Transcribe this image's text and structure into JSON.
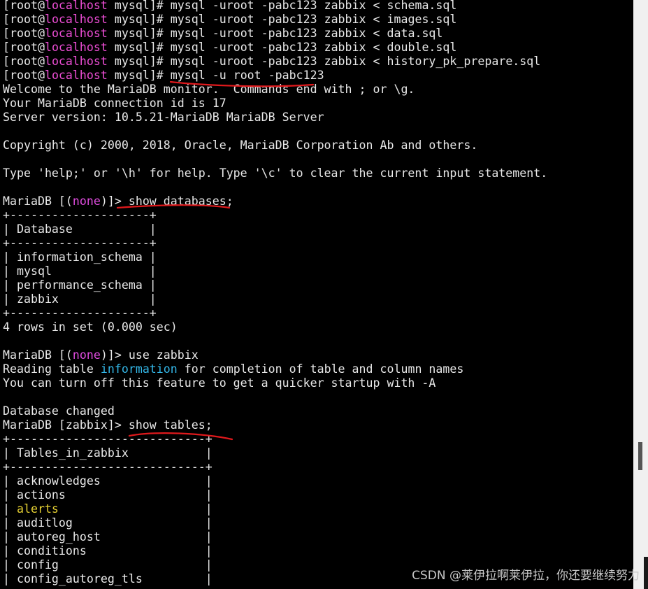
{
  "terminal": {
    "lines": [
      {
        "segs": [
          {
            "t": "[root@"
          },
          {
            "t": "localhost",
            "c": "host"
          },
          {
            "t": " mysql]# mysql -uroot -pabc123 zabbix < schema.sql"
          }
        ]
      },
      {
        "segs": [
          {
            "t": "[root@"
          },
          {
            "t": "localhost",
            "c": "host"
          },
          {
            "t": " mysql]# mysql -uroot -pabc123 zabbix < images.sql"
          }
        ]
      },
      {
        "segs": [
          {
            "t": "[root@"
          },
          {
            "t": "localhost",
            "c": "host"
          },
          {
            "t": " mysql]# mysql -uroot -pabc123 zabbix < data.sql"
          }
        ]
      },
      {
        "segs": [
          {
            "t": "[root@"
          },
          {
            "t": "localhost",
            "c": "host"
          },
          {
            "t": " mysql]# mysql -uroot -pabc123 zabbix < double.sql"
          }
        ]
      },
      {
        "segs": [
          {
            "t": "[root@"
          },
          {
            "t": "localhost",
            "c": "host"
          },
          {
            "t": " mysql]# mysql -uroot -pabc123 zabbix < history_pk_prepare.sql"
          }
        ]
      },
      {
        "segs": [
          {
            "t": "[root@"
          },
          {
            "t": "localhost",
            "c": "host"
          },
          {
            "t": " mysql]# mysql -u root -pabc123"
          }
        ]
      },
      {
        "segs": [
          {
            "t": "Welcome to the MariaDB monitor.  Commands end with ; or \\g."
          }
        ]
      },
      {
        "segs": [
          {
            "t": "Your MariaDB connection id is 17"
          }
        ]
      },
      {
        "segs": [
          {
            "t": "Server version: 10.5.21-MariaDB MariaDB Server"
          }
        ]
      },
      {
        "segs": [
          {
            "t": ""
          }
        ]
      },
      {
        "segs": [
          {
            "t": "Copyright (c) 2000, 2018, Oracle, MariaDB Corporation Ab and others."
          }
        ]
      },
      {
        "segs": [
          {
            "t": ""
          }
        ]
      },
      {
        "segs": [
          {
            "t": "Type 'help;' or '\\h' for help. Type '\\c' to clear the current input statement."
          }
        ]
      },
      {
        "segs": [
          {
            "t": ""
          }
        ]
      },
      {
        "segs": [
          {
            "t": "MariaDB [("
          },
          {
            "t": "none",
            "c": "none"
          },
          {
            "t": ")]> show databases;"
          }
        ]
      },
      {
        "segs": [
          {
            "t": "+--------------------+"
          }
        ]
      },
      {
        "segs": [
          {
            "t": "| Database           |"
          }
        ]
      },
      {
        "segs": [
          {
            "t": "+--------------------+"
          }
        ]
      },
      {
        "segs": [
          {
            "t": "| information_schema |"
          }
        ]
      },
      {
        "segs": [
          {
            "t": "| mysql              |"
          }
        ]
      },
      {
        "segs": [
          {
            "t": "| performance_schema |"
          }
        ]
      },
      {
        "segs": [
          {
            "t": "| zabbix             |"
          }
        ]
      },
      {
        "segs": [
          {
            "t": "+--------------------+"
          }
        ]
      },
      {
        "segs": [
          {
            "t": "4 rows in set (0.000 sec)"
          }
        ]
      },
      {
        "segs": [
          {
            "t": ""
          }
        ]
      },
      {
        "segs": [
          {
            "t": "MariaDB [("
          },
          {
            "t": "none",
            "c": "none"
          },
          {
            "t": ")]> use zabbix"
          }
        ]
      },
      {
        "segs": [
          {
            "t": "Reading table "
          },
          {
            "t": "information",
            "c": "info"
          },
          {
            "t": " for completion of table and column names"
          }
        ]
      },
      {
        "segs": [
          {
            "t": "You can turn off this feature to get a quicker startup with -A"
          }
        ]
      },
      {
        "segs": [
          {
            "t": ""
          }
        ]
      },
      {
        "segs": [
          {
            "t": "Database changed"
          }
        ]
      },
      {
        "segs": [
          {
            "t": "MariaDB [zabbix]> show tables;"
          }
        ]
      },
      {
        "segs": [
          {
            "t": "+----------------------------+"
          }
        ]
      },
      {
        "segs": [
          {
            "t": "| Tables_in_zabbix           |"
          }
        ]
      },
      {
        "segs": [
          {
            "t": "+----------------------------+"
          }
        ]
      },
      {
        "segs": [
          {
            "t": "| acknowledges               |"
          }
        ]
      },
      {
        "segs": [
          {
            "t": "| actions                    |"
          }
        ]
      },
      {
        "segs": [
          {
            "t": "| "
          },
          {
            "t": "alerts",
            "c": "alerts"
          },
          {
            "t": "                     |"
          }
        ]
      },
      {
        "segs": [
          {
            "t": "| auditlog                   |"
          }
        ]
      },
      {
        "segs": [
          {
            "t": "| autoreg_host               |"
          }
        ]
      },
      {
        "segs": [
          {
            "t": "| conditions                 |"
          }
        ]
      },
      {
        "segs": [
          {
            "t": "| config                     |"
          }
        ]
      },
      {
        "segs": [
          {
            "t": "| config_autoreg_tls         |"
          }
        ]
      }
    ]
  },
  "colors": {
    "background": "#000000",
    "text": "#e8e8e8",
    "hostname": "#ee4ed6",
    "none_keyword": "#e14de0",
    "information_keyword": "#33b7e8",
    "alerts_keyword": "#e5d033",
    "annotation": "#e0191c"
  },
  "watermark": {
    "text": "CSDN @莱伊拉啊莱伊拉，你还要继续努力"
  }
}
